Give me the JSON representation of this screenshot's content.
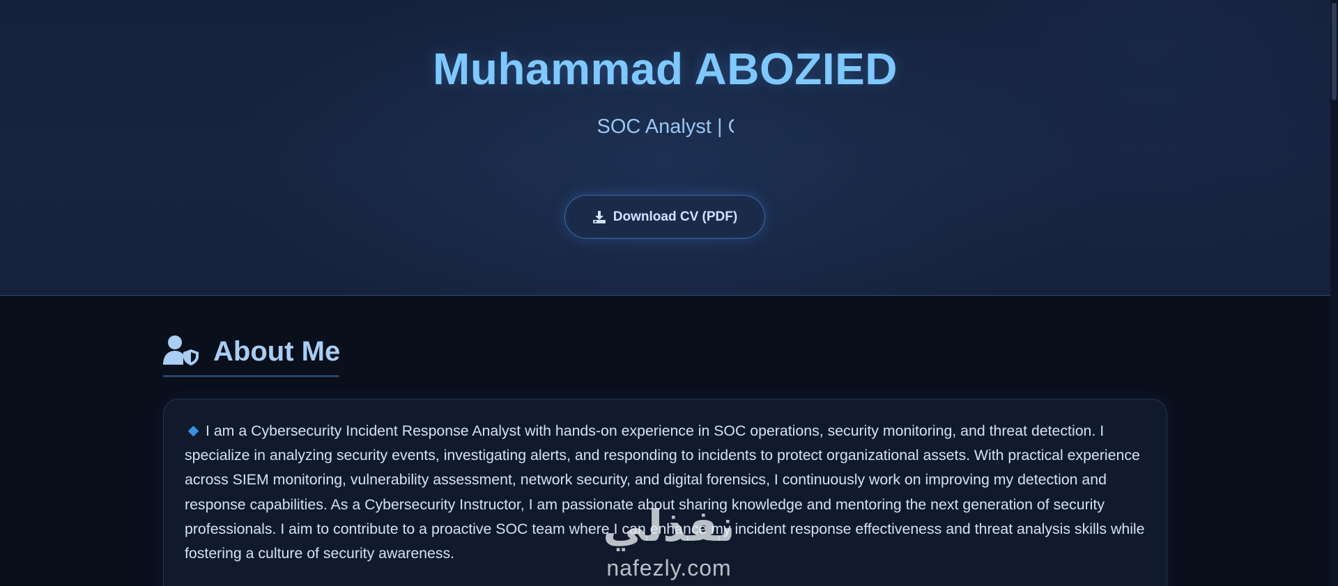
{
  "hero": {
    "name": "Muhammad ABOZIED",
    "subtitle": "SOC Analyst | C",
    "cv_button_label": "Download CV (PDF)"
  },
  "about": {
    "heading": "About Me",
    "text": "I am a Cybersecurity Incident Response Analyst with hands-on experience in SOC operations, security monitoring, and threat detection. I specialize in analyzing security events, investigating alerts, and responding to incidents to protect organizational assets. With practical experience across SIEM monitoring, vulnerability assessment, network security, and digital forensics, I continuously work on improving my detection and response capabilities. As a Cybersecurity Instructor, I am passionate about sharing knowledge and mentoring the next generation of security professionals. I aim to contribute to a proactive SOC team where I can enhance my incident response effectiveness and threat analysis skills while fostering a culture of security awareness."
  },
  "watermark": {
    "arabic": "نفذلي",
    "latin": "nafezly.com"
  },
  "icons": {
    "download": "download-icon",
    "about": "user-shield-icon",
    "bullet": "small-blue-diamond-icon"
  },
  "colors": {
    "name": "#7fc8ff",
    "subtitle": "#9cc6f2",
    "heading": "#a9cdf3",
    "bullet": "#3b8fe0",
    "hero_bg": "#17243f",
    "section_bg": "#0a0f1c"
  }
}
